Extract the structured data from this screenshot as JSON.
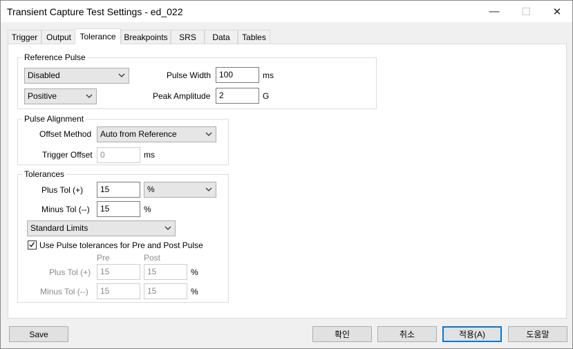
{
  "window": {
    "title": "Transient Capture Test Settings - ed_022",
    "minimize_glyph": "—",
    "maximize_glyph": "☐",
    "close_glyph": "✕"
  },
  "tabs": [
    {
      "label": "Trigger",
      "active": false
    },
    {
      "label": "Output",
      "active": false
    },
    {
      "label": "Tolerance",
      "active": true
    },
    {
      "label": "Breakpoints",
      "active": false
    },
    {
      "label": "SRS",
      "active": false
    },
    {
      "label": "Data",
      "active": false
    },
    {
      "label": "Tables",
      "active": false
    }
  ],
  "reference_pulse": {
    "title": "Reference Pulse",
    "type_select": "Disabled",
    "polarity_select": "Positive",
    "pulse_width_label": "Pulse Width",
    "pulse_width_value": "100",
    "pulse_width_unit": "ms",
    "peak_amplitude_label": "Peak Amplitude",
    "peak_amplitude_value": "2",
    "peak_amplitude_unit": "G"
  },
  "pulse_alignment": {
    "title": "Pulse Alignment",
    "offset_method_label": "Offset Method",
    "offset_method_value": "Auto from Reference",
    "trigger_offset_label": "Trigger Offset",
    "trigger_offset_value": "0",
    "trigger_offset_unit": "ms"
  },
  "tolerances": {
    "title": "Tolerances",
    "plus_tol_label": "Plus Tol (+)",
    "plus_tol_value": "15",
    "plus_tol_unit_select": "%",
    "minus_tol_label": "Minus Tol (--)",
    "minus_tol_value": "15",
    "minus_tol_unit": "%",
    "limits_select": "Standard Limits",
    "use_pulse_checkbox_label": "Use Pulse tolerances for Pre and Post Pulse",
    "use_pulse_checked": true,
    "pre_header": "Pre",
    "post_header": "Post",
    "pp_plus_label": "Plus Tol (+)",
    "pp_plus_pre": "15",
    "pp_plus_post": "15",
    "pp_plus_unit": "%",
    "pp_minus_label": "Minus Tol (--)",
    "pp_minus_pre": "15",
    "pp_minus_post": "15",
    "pp_minus_unit": "%"
  },
  "footer": {
    "save_label": "Save",
    "ok_label": "확인",
    "cancel_label": "취소",
    "apply_label": "적용(A)",
    "help_label": "도움말"
  },
  "colors": {
    "accent": "#0078d7",
    "panel": "#ffffff",
    "background": "#f0f0f0"
  }
}
